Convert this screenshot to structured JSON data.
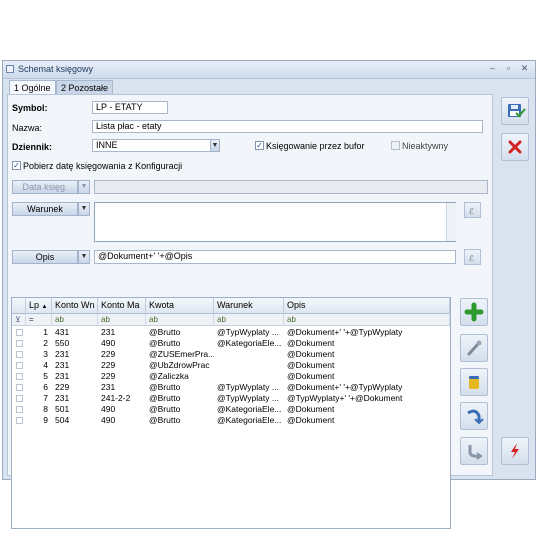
{
  "window": {
    "title": "Schemat księgowy"
  },
  "tabs": [
    {
      "label": "1 Ogólne"
    },
    {
      "label": "2 Pozostałe"
    }
  ],
  "form": {
    "symbol_label": "Symbol:",
    "symbol_value": "LP - ETATY",
    "nazwa_label": "Nazwa:",
    "nazwa_value": "Lista płac - etaty",
    "dziennik_label": "Dziennik:",
    "dziennik_value": "INNE",
    "ksiegowanie_bufor_label": "Księgowanie przez bufor",
    "ksiegowanie_bufor_checked": true,
    "nieaktywny_label": "Nieaktywny",
    "nieaktywny_checked": false,
    "pobierz_date_label": "Pobierz datę księgowania z Konfiguracji",
    "pobierz_date_checked": true,
    "data_ksieg_button": "Data księg.",
    "warunek_button": "Warunek",
    "warunek_value": "",
    "opis_button": "Opis",
    "opis_value": "@Dokument+' '+@Opis"
  },
  "grid": {
    "columns": [
      "Lp",
      "Konto Wn",
      "Konto Ma",
      "Kwota",
      "Warunek",
      "Opis"
    ],
    "filter_row": [
      "=",
      "ab",
      "ab",
      "ab",
      "ab",
      "ab"
    ],
    "rows": [
      {
        "lp": "1",
        "wn": "431",
        "ma": "231",
        "kwota": "@Brutto",
        "warunek": "@TypWyplaty ...",
        "opis": "@Dokument+' '+@TypWyplaty"
      },
      {
        "lp": "2",
        "wn": "550",
        "ma": "490",
        "kwota": "@Brutto",
        "warunek": "@KategoriaEle...",
        "opis": "@Dokument"
      },
      {
        "lp": "3",
        "wn": "231",
        "ma": "229",
        "kwota": "@ZUSEmerPra...",
        "warunek": "",
        "opis": "@Dokument"
      },
      {
        "lp": "4",
        "wn": "231",
        "ma": "229",
        "kwota": "@UbZdrowPrac",
        "warunek": "",
        "opis": "@Dokument"
      },
      {
        "lp": "5",
        "wn": "231",
        "ma": "229",
        "kwota": "@Zaliczka",
        "warunek": "",
        "opis": "@Dokument"
      },
      {
        "lp": "6",
        "wn": "229",
        "ma": "231",
        "kwota": "@Brutto",
        "warunek": "@TypWyplaty ...",
        "opis": "@Dokument+' '+@TypWyplaty"
      },
      {
        "lp": "7",
        "wn": "231",
        "ma": "241-2-2",
        "kwota": "@Brutto",
        "warunek": "@TypWyplaty ...",
        "opis": "@TypWyplaty+' '+@Dokument"
      },
      {
        "lp": "8",
        "wn": "501",
        "ma": "490",
        "kwota": "@Brutto",
        "warunek": "@KategoriaEle...",
        "opis": "@Dokument"
      },
      {
        "lp": "9",
        "wn": "504",
        "ma": "490",
        "kwota": "@Brutto",
        "warunek": "@KategoriaEle...",
        "opis": "@Dokument"
      }
    ]
  },
  "icons": {
    "save": "save-icon",
    "cancel": "cancel-icon",
    "add": "add-icon",
    "edit": "edit-icon",
    "delete": "delete-icon",
    "up": "move-up-icon",
    "down": "move-down-icon",
    "execute": "execute-icon",
    "clear": "clear-icon"
  },
  "colors": {
    "accent": "#1e395b",
    "add_green": "#2e9a2e",
    "cancel_red": "#d42020"
  }
}
